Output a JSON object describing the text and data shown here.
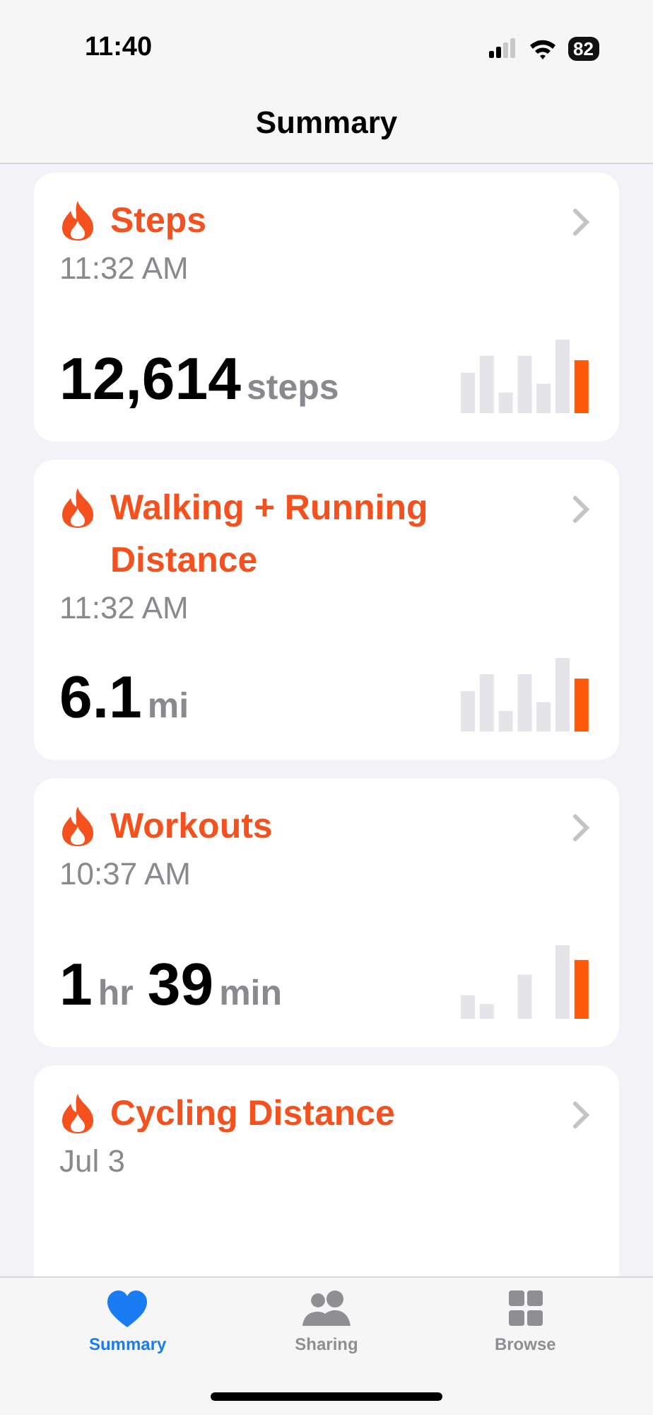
{
  "status_bar": {
    "time": "11:40",
    "battery": "82"
  },
  "title": "Summary",
  "cards": [
    {
      "title": "Steps",
      "time": "11:32 AM",
      "value": [
        {
          "kind": "number",
          "text": "12,614"
        },
        {
          "kind": "unit",
          "text": "steps"
        }
      ]
    },
    {
      "title": "Walking + Running Distance",
      "time": "11:32 AM",
      "value": [
        {
          "kind": "number",
          "text": "6.1"
        },
        {
          "kind": "unit",
          "text": "mi"
        }
      ]
    },
    {
      "title": "Workouts",
      "time": "10:37 AM",
      "value": [
        {
          "kind": "number",
          "text": "1"
        },
        {
          "kind": "unit",
          "text": "hr"
        },
        {
          "kind": "number",
          "text": "39"
        },
        {
          "kind": "unit",
          "text": "min"
        }
      ]
    },
    {
      "title": "Cycling Distance",
      "time": "Jul 3"
    }
  ],
  "tabs": [
    {
      "label": "Summary",
      "kind": "heart",
      "selected": true
    },
    {
      "label": "Sharing",
      "kind": "people",
      "selected": false
    },
    {
      "label": "Browse",
      "kind": "grid",
      "selected": false
    }
  ]
}
